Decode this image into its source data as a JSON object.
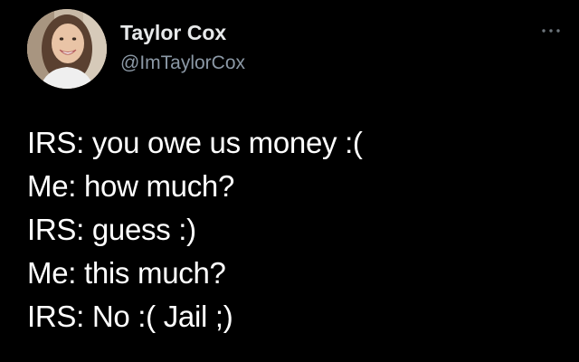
{
  "author": {
    "name": "Taylor Cox",
    "handle": "@ImTaylorCox",
    "avatar_icon": "profile-photo"
  },
  "menu": {
    "icon": "more-horizontal-icon"
  },
  "tweet": {
    "lines": [
      "IRS: you owe us money :(",
      "Me: how much?",
      "IRS: guess :)",
      "Me: this much?",
      "IRS: No :( Jail ;)"
    ]
  },
  "colors": {
    "background": "#000000",
    "name_text": "#e7e9ea",
    "handle_text": "#8b98a5",
    "body_text": "#ffffff"
  }
}
